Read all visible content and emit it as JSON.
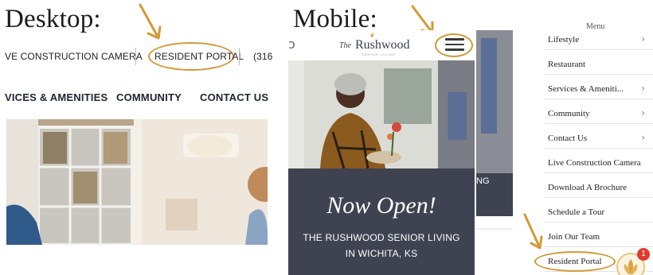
{
  "labels": {
    "desktop": "Desktop:",
    "mobile": "Mobile:"
  },
  "desktop": {
    "topbar": {
      "construction_camera": "VE CONSTRUCTION CAMERA",
      "resident_portal": "RESIDENT PORTAL",
      "phone": "(316"
    },
    "nav": {
      "services": "VICES & AMENITIES",
      "community": "COMMUNITY",
      "contact": "CONTACT US"
    }
  },
  "mobile": {
    "logo_text": "Rushwood",
    "logo_prefix": "The",
    "logo_subtext": "SENIOR LIVING",
    "hero_script": "Now Open!",
    "hero_line1": "THE RUSHWOOD SENIOR LIVING",
    "hero_line2": "IN WICHITA, KS",
    "side_text": "NG"
  },
  "menu": {
    "header": "Menu",
    "items": [
      {
        "label": "Lifestyle",
        "chevron": true
      },
      {
        "label": "Restaurant",
        "chevron": false
      },
      {
        "label": "Services & Ameniti...",
        "chevron": true
      },
      {
        "label": "Community",
        "chevron": true
      },
      {
        "label": "Contact Us",
        "chevron": true
      },
      {
        "label": "Live Construction Camera",
        "chevron": false
      },
      {
        "label": "Download A Brochure",
        "chevron": false
      },
      {
        "label": "Schedule a Tour",
        "chevron": false
      },
      {
        "label": "Join Our Team",
        "chevron": false
      },
      {
        "label": "Resident Portal",
        "chevron": false
      }
    ],
    "chevron_glyph": "›"
  },
  "chat": {
    "badge_count": "1"
  },
  "colors": {
    "annotation": "#d39a35",
    "hero_panel": "#3f4351",
    "nav_text": "#1e2430"
  }
}
